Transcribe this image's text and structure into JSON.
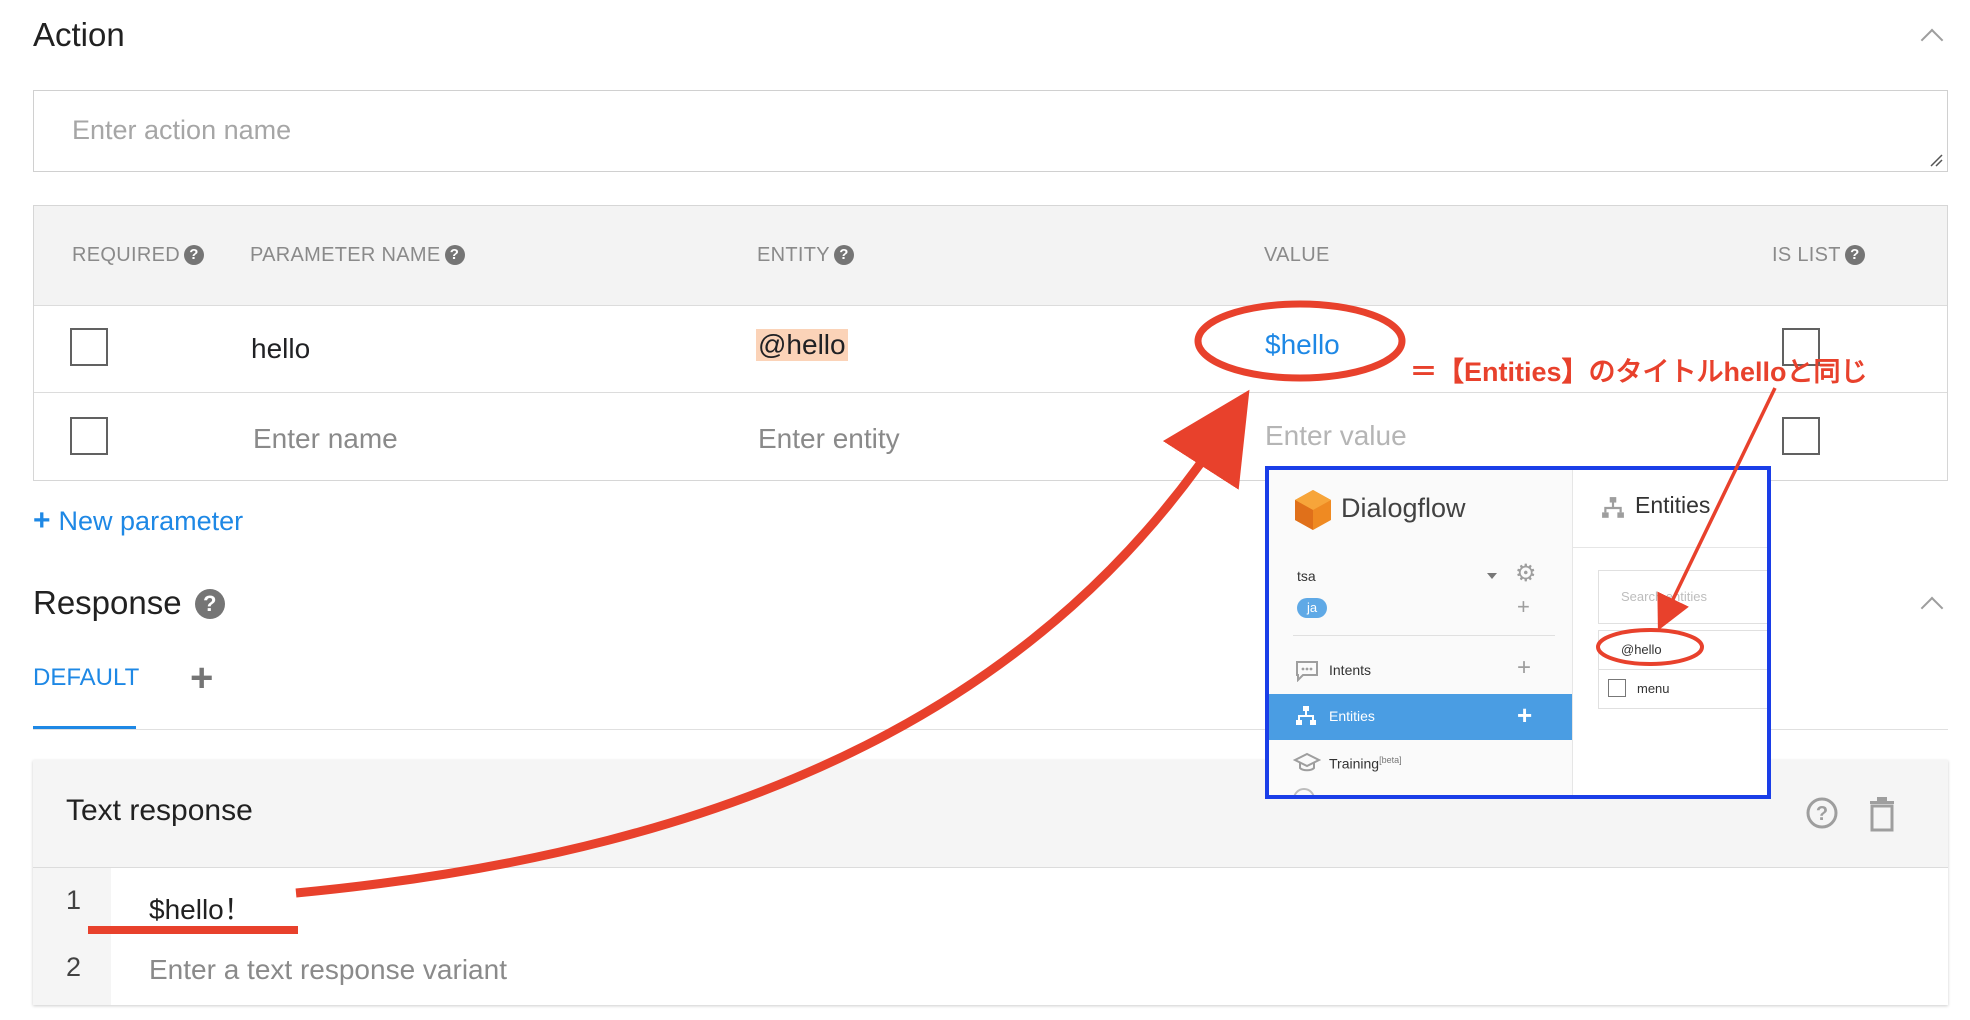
{
  "action": {
    "title": "Action",
    "input_placeholder": "Enter action name"
  },
  "params_table": {
    "headers": {
      "required": "REQUIRED",
      "parameter_name": "PARAMETER NAME",
      "entity": "ENTITY",
      "value": "VALUE",
      "is_list": "IS LIST"
    },
    "rows": [
      {
        "required": false,
        "name": "hello",
        "entity": "@hello",
        "value": "$hello",
        "is_list": false
      }
    ],
    "placeholders": {
      "name": "Enter name",
      "entity": "Enter entity",
      "value": "Enter value"
    },
    "new_parameter_label": "New parameter"
  },
  "response": {
    "title": "Response",
    "tab_default": "DEFAULT",
    "text_response": {
      "title": "Text response",
      "lines": [
        {
          "num": "1",
          "text": "$hello！"
        },
        {
          "num": "2",
          "placeholder": "Enter a text response variant"
        }
      ]
    }
  },
  "annotation": {
    "note": "＝【Entities】のタイトルhelloと同じ",
    "color": "#e8412c"
  },
  "inset": {
    "brand": "Dialogflow",
    "agent": "tsa",
    "lang_badge": "ja",
    "nav": [
      {
        "label": "Intents",
        "active": false
      },
      {
        "label": "Entities",
        "active": true
      },
      {
        "label": "Training",
        "sup": "[beta]",
        "active": false
      }
    ],
    "panel_title": "Entities",
    "search_placeholder": "Search entities",
    "entities": [
      "@hello",
      "menu"
    ]
  },
  "colors": {
    "link_blue": "#1e88e5",
    "entity_highlight": "#fbd3b8",
    "active_nav": "#4a9de3",
    "inset_border": "#1a3ee8"
  }
}
